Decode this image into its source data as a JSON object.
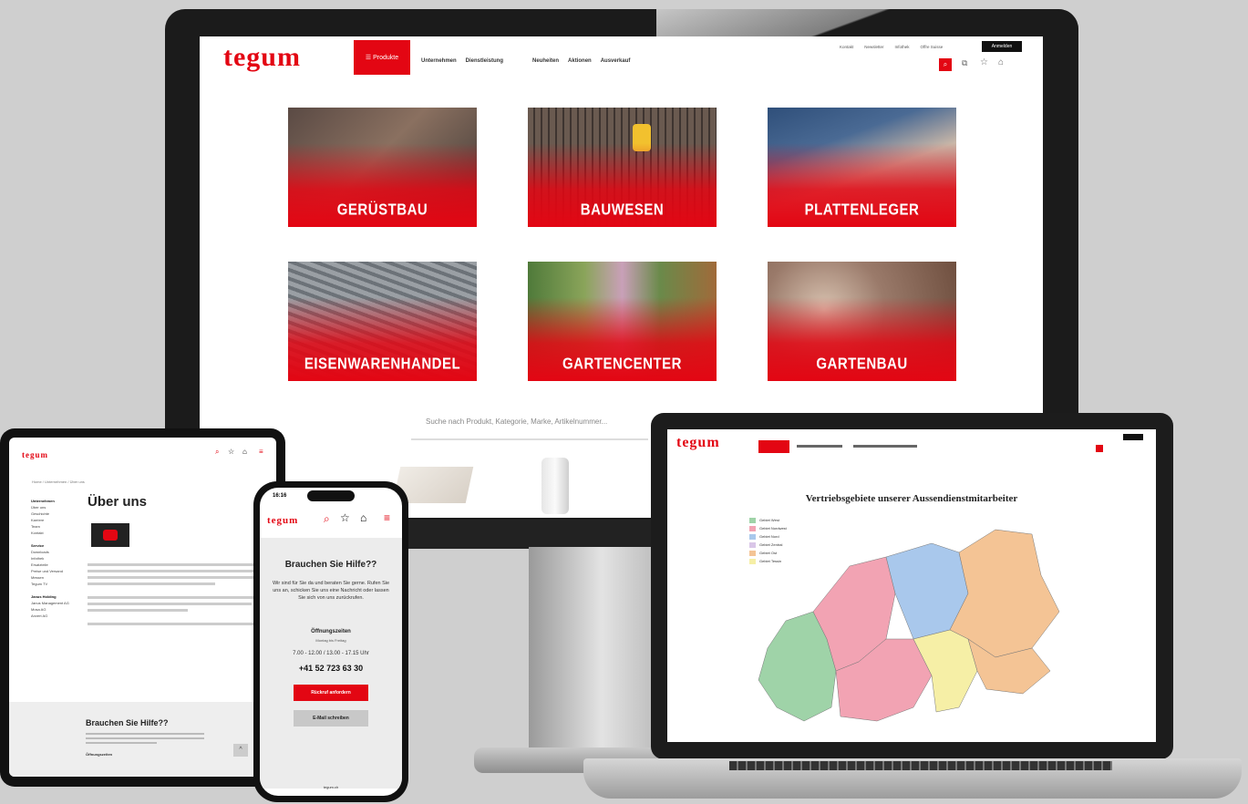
{
  "imac": {
    "logo": "tegum",
    "nav_products": "☰ Produkte",
    "nav_links": [
      "Unternehmen",
      "Dienstleistung",
      "Neuheiten",
      "Aktionen",
      "Ausverkauf"
    ],
    "util_links": [
      "Kontakt",
      "Newsletter",
      "Infothek",
      "Offre Suisse"
    ],
    "login_label": "Anmelden",
    "categories": [
      "GERÜSTBAU",
      "BAUWESEN",
      "PLATTENLEGER",
      "EISENWARENHANDEL",
      "GARTENCENTER",
      "GARTENBAU"
    ],
    "search_placeholder": "Suche nach Produkt, Kategorie, Marke, Artikelnummer..."
  },
  "tablet": {
    "logo": "tegum",
    "breadcrumb": "Home / Unternehmen / Über uns",
    "page_title": "Über uns",
    "sidebar_groups": [
      {
        "title": "Unternehmen",
        "items": [
          "Über uns",
          "Geschichte",
          "Karriere",
          "Team",
          "Kontakt"
        ]
      },
      {
        "title": "Service",
        "items": [
          "Downloads",
          "Infothek",
          "Ersatzteile",
          "Preise und Versand",
          "Messen",
          "Tegum TV"
        ]
      },
      {
        "title": "Janus Holding",
        "items": [
          "Janus Management AG",
          "Mosa AG",
          "Anvert AG"
        ]
      }
    ],
    "help_title": "Brauchen Sie Hilfe??",
    "hours_label": "Öffnungszeiten"
  },
  "phone": {
    "time": "16:16",
    "logo": "tegum",
    "help_title": "Brauchen Sie Hilfe??",
    "help_text": "Wir sind für Sie da und beraten Sie gerne. Rufen Sie uns an, schicken Sie uns eine Nachricht oder lassen Sie sich von uns zurückrufen.",
    "hours_label": "Öffnungszeiten",
    "hours_days": "Montag bis Freitag",
    "hours_time": "7.00 - 12.00 / 13.00 - 17.15 Uhr",
    "phone_number": "+41 52 723 63 30",
    "callback_button": "Rückruf anfordern",
    "email_button": "E-Mail schreiben",
    "url": "tegum.ch"
  },
  "laptop": {
    "logo": "tegum",
    "map_title": "Vertriebsgebiete unserer Aussendienstmitarbeiter",
    "legend": [
      {
        "label": "Gebiet West",
        "color": "#9fd3a8"
      },
      {
        "label": "Gebiet Nordwest",
        "color": "#f2a3b3"
      },
      {
        "label": "Gebiet Nord",
        "color": "#a9c8ec"
      },
      {
        "label": "Gebiet Zentral",
        "color": "#d9c6e8"
      },
      {
        "label": "Gebiet Ost",
        "color": "#f4c495"
      },
      {
        "label": "Gebiet Tessin",
        "color": "#f6efa6"
      }
    ]
  }
}
